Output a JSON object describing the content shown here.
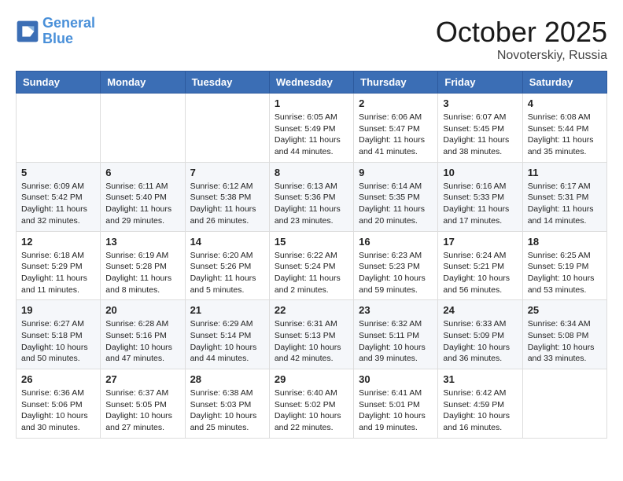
{
  "header": {
    "logo_line1": "General",
    "logo_line2": "Blue",
    "month": "October 2025",
    "location": "Novoterskiy, Russia"
  },
  "weekdays": [
    "Sunday",
    "Monday",
    "Tuesday",
    "Wednesday",
    "Thursday",
    "Friday",
    "Saturday"
  ],
  "weeks": [
    [
      {
        "day": "",
        "info": ""
      },
      {
        "day": "",
        "info": ""
      },
      {
        "day": "",
        "info": ""
      },
      {
        "day": "1",
        "info": "Sunrise: 6:05 AM\nSunset: 5:49 PM\nDaylight: 11 hours and 44 minutes."
      },
      {
        "day": "2",
        "info": "Sunrise: 6:06 AM\nSunset: 5:47 PM\nDaylight: 11 hours and 41 minutes."
      },
      {
        "day": "3",
        "info": "Sunrise: 6:07 AM\nSunset: 5:45 PM\nDaylight: 11 hours and 38 minutes."
      },
      {
        "day": "4",
        "info": "Sunrise: 6:08 AM\nSunset: 5:44 PM\nDaylight: 11 hours and 35 minutes."
      }
    ],
    [
      {
        "day": "5",
        "info": "Sunrise: 6:09 AM\nSunset: 5:42 PM\nDaylight: 11 hours and 32 minutes."
      },
      {
        "day": "6",
        "info": "Sunrise: 6:11 AM\nSunset: 5:40 PM\nDaylight: 11 hours and 29 minutes."
      },
      {
        "day": "7",
        "info": "Sunrise: 6:12 AM\nSunset: 5:38 PM\nDaylight: 11 hours and 26 minutes."
      },
      {
        "day": "8",
        "info": "Sunrise: 6:13 AM\nSunset: 5:36 PM\nDaylight: 11 hours and 23 minutes."
      },
      {
        "day": "9",
        "info": "Sunrise: 6:14 AM\nSunset: 5:35 PM\nDaylight: 11 hours and 20 minutes."
      },
      {
        "day": "10",
        "info": "Sunrise: 6:16 AM\nSunset: 5:33 PM\nDaylight: 11 hours and 17 minutes."
      },
      {
        "day": "11",
        "info": "Sunrise: 6:17 AM\nSunset: 5:31 PM\nDaylight: 11 hours and 14 minutes."
      }
    ],
    [
      {
        "day": "12",
        "info": "Sunrise: 6:18 AM\nSunset: 5:29 PM\nDaylight: 11 hours and 11 minutes."
      },
      {
        "day": "13",
        "info": "Sunrise: 6:19 AM\nSunset: 5:28 PM\nDaylight: 11 hours and 8 minutes."
      },
      {
        "day": "14",
        "info": "Sunrise: 6:20 AM\nSunset: 5:26 PM\nDaylight: 11 hours and 5 minutes."
      },
      {
        "day": "15",
        "info": "Sunrise: 6:22 AM\nSunset: 5:24 PM\nDaylight: 11 hours and 2 minutes."
      },
      {
        "day": "16",
        "info": "Sunrise: 6:23 AM\nSunset: 5:23 PM\nDaylight: 10 hours and 59 minutes."
      },
      {
        "day": "17",
        "info": "Sunrise: 6:24 AM\nSunset: 5:21 PM\nDaylight: 10 hours and 56 minutes."
      },
      {
        "day": "18",
        "info": "Sunrise: 6:25 AM\nSunset: 5:19 PM\nDaylight: 10 hours and 53 minutes."
      }
    ],
    [
      {
        "day": "19",
        "info": "Sunrise: 6:27 AM\nSunset: 5:18 PM\nDaylight: 10 hours and 50 minutes."
      },
      {
        "day": "20",
        "info": "Sunrise: 6:28 AM\nSunset: 5:16 PM\nDaylight: 10 hours and 47 minutes."
      },
      {
        "day": "21",
        "info": "Sunrise: 6:29 AM\nSunset: 5:14 PM\nDaylight: 10 hours and 44 minutes."
      },
      {
        "day": "22",
        "info": "Sunrise: 6:31 AM\nSunset: 5:13 PM\nDaylight: 10 hours and 42 minutes."
      },
      {
        "day": "23",
        "info": "Sunrise: 6:32 AM\nSunset: 5:11 PM\nDaylight: 10 hours and 39 minutes."
      },
      {
        "day": "24",
        "info": "Sunrise: 6:33 AM\nSunset: 5:09 PM\nDaylight: 10 hours and 36 minutes."
      },
      {
        "day": "25",
        "info": "Sunrise: 6:34 AM\nSunset: 5:08 PM\nDaylight: 10 hours and 33 minutes."
      }
    ],
    [
      {
        "day": "26",
        "info": "Sunrise: 6:36 AM\nSunset: 5:06 PM\nDaylight: 10 hours and 30 minutes."
      },
      {
        "day": "27",
        "info": "Sunrise: 6:37 AM\nSunset: 5:05 PM\nDaylight: 10 hours and 27 minutes."
      },
      {
        "day": "28",
        "info": "Sunrise: 6:38 AM\nSunset: 5:03 PM\nDaylight: 10 hours and 25 minutes."
      },
      {
        "day": "29",
        "info": "Sunrise: 6:40 AM\nSunset: 5:02 PM\nDaylight: 10 hours and 22 minutes."
      },
      {
        "day": "30",
        "info": "Sunrise: 6:41 AM\nSunset: 5:01 PM\nDaylight: 10 hours and 19 minutes."
      },
      {
        "day": "31",
        "info": "Sunrise: 6:42 AM\nSunset: 4:59 PM\nDaylight: 10 hours and 16 minutes."
      },
      {
        "day": "",
        "info": ""
      }
    ]
  ]
}
